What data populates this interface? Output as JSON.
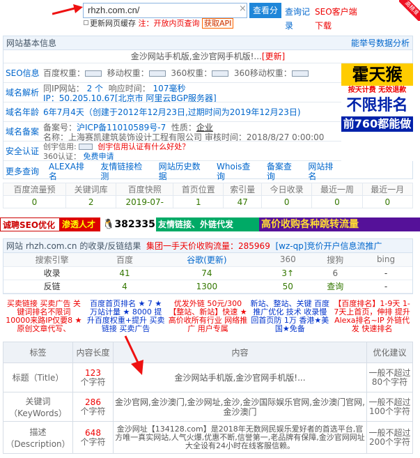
{
  "top": {
    "search_value": "rhzh.com.cn/",
    "clear": "×",
    "search_btn": "查看分析",
    "link1": "查询记录",
    "link2": "SEO客户端下载",
    "corner": "高精准",
    "opt1": "更新网页缓存",
    "opt2": "注：开放内页查询",
    "opt3": "获取API"
  },
  "basic": {
    "title": "网站基本信息",
    "right_link": "能举号数据分析",
    "site_title": "金沙网站手机版,金沙官网手机版!...",
    "update": "[更新]"
  },
  "rows": [
    {
      "label": "SEO信息",
      "text": "百度权重：",
      "t2": "移动权重：",
      "t3": "360权重：",
      "t4": "360移动权重："
    },
    {
      "label": "域名解析",
      "l1": "同IP网站：",
      "v1": "2 个",
      "l2": "响应时间：",
      "v2": "107毫秒",
      "l3": "IP：50.205.10.67[北京市 阿里云BGP服务器]"
    },
    {
      "label": "域名年龄",
      "text": "6年7月4天（创建于2012年12月23日,过期时间为2019年12月23日)"
    },
    {
      "label": "域名备案",
      "l1": "备案号：",
      "v1": "沪ICP备11010589号-7",
      "l2": "性质：",
      "v2": "企业",
      "l3": "名称：上海赛凯建筑装饰设计工程有限公司  审核时间：2018/8/27 0:00:00"
    },
    {
      "label": "安全认证",
      "l1": "创宇信用:",
      "v1": "创宇信用认证有什么好处？",
      "l2": "360认证：",
      "v2": "免费申请"
    }
  ],
  "more": {
    "label": "更多查询",
    "links": [
      "ALEXA排名",
      "友情链接检测",
      "网站历史数据",
      "Whois查询",
      "备案查询",
      "网站排名"
    ]
  },
  "ad_right": {
    "line1": "霍天猴",
    "line2": "按天计费 无效退款",
    "line3": "不限排名",
    "line4": "前760都能做"
  },
  "stats": {
    "headers": [
      "百度流量预",
      "关键词库",
      "百度快照",
      "首页位置",
      "索引量",
      "今日收录",
      "最近一周",
      "最近一月"
    ],
    "values": [
      "0",
      "2",
      "2019-07-",
      "1",
      "47",
      "0",
      "0",
      "0"
    ]
  },
  "banner": [
    "诚聘SEO优化",
    "渗透人才",
    "3823355",
    "友情链接、外链代发",
    "高价收购各种跳转流量"
  ],
  "index": {
    "title": "网站 rhzh.com.cn 的收录/反链结果",
    "promo": "集团一手天价收购流量：285969",
    "qq": "[wz-qp]",
    "promo2": "竞价开户信息流推广",
    "headers": [
      "搜索引擎",
      "百度",
      "谷歌(更新)",
      "360",
      "搜狗",
      "bing"
    ],
    "rows": [
      [
        "收录",
        "41",
        "74",
        "3↑",
        "6",
        "-"
      ],
      [
        "反链",
        "4",
        "1300",
        "50",
        "查询",
        "-"
      ]
    ]
  },
  "ads": [
    "买卖链接 买卖广告 关键词排名不限词 10000来路IP仅要8 ★ 原创文章代写、",
    "百度首页排名 ★ 7 ★万站计量 ★ 8000 提升百度权重+提升 买卖链接 买卖广告",
    "优发外链 50元/300 【整站、新站】快速 ★ 高价收所有行业 网络推广 用户专属",
    "新站、整站、关键 百度推广优化 技术 收录慢回首页防 1万 香港★美国★免备",
    "【百度排名】1-9天 1-7天上首页，伸排 提升Alexa排名~IP 外链代发 快速排名"
  ],
  "tdk": {
    "headers": [
      "标签",
      "内容长度",
      "内容",
      "优化建议"
    ],
    "rows": [
      {
        "tag": "标题（Title）",
        "len": "123",
        "unit": "个字符",
        "content": "金沙网站手机版,金沙官网手机版!...",
        "advice": "一般不超过80个字符"
      },
      {
        "tag": "关键词（KeyWords）",
        "len": "286",
        "unit": "个字符",
        "content": "金沙官网,金沙澳门,金沙网址,金沙,金沙国际娱乐官网,金沙澳门官网,金沙澳门",
        "advice": "一般不超过100个字符"
      },
      {
        "tag": "描述（Description）",
        "len": "648",
        "unit": "个字符",
        "content": "金沙网址【134128.com】是2018年无数网民娱乐爱好者的首选平台,官方唯一真实网站,人气火爆,优惠不断,信誉第一,老品牌有保障,金沙官网网址大全设有24小时在线客服信赖。",
        "advice": "一般不超过200个字符"
      }
    ]
  }
}
